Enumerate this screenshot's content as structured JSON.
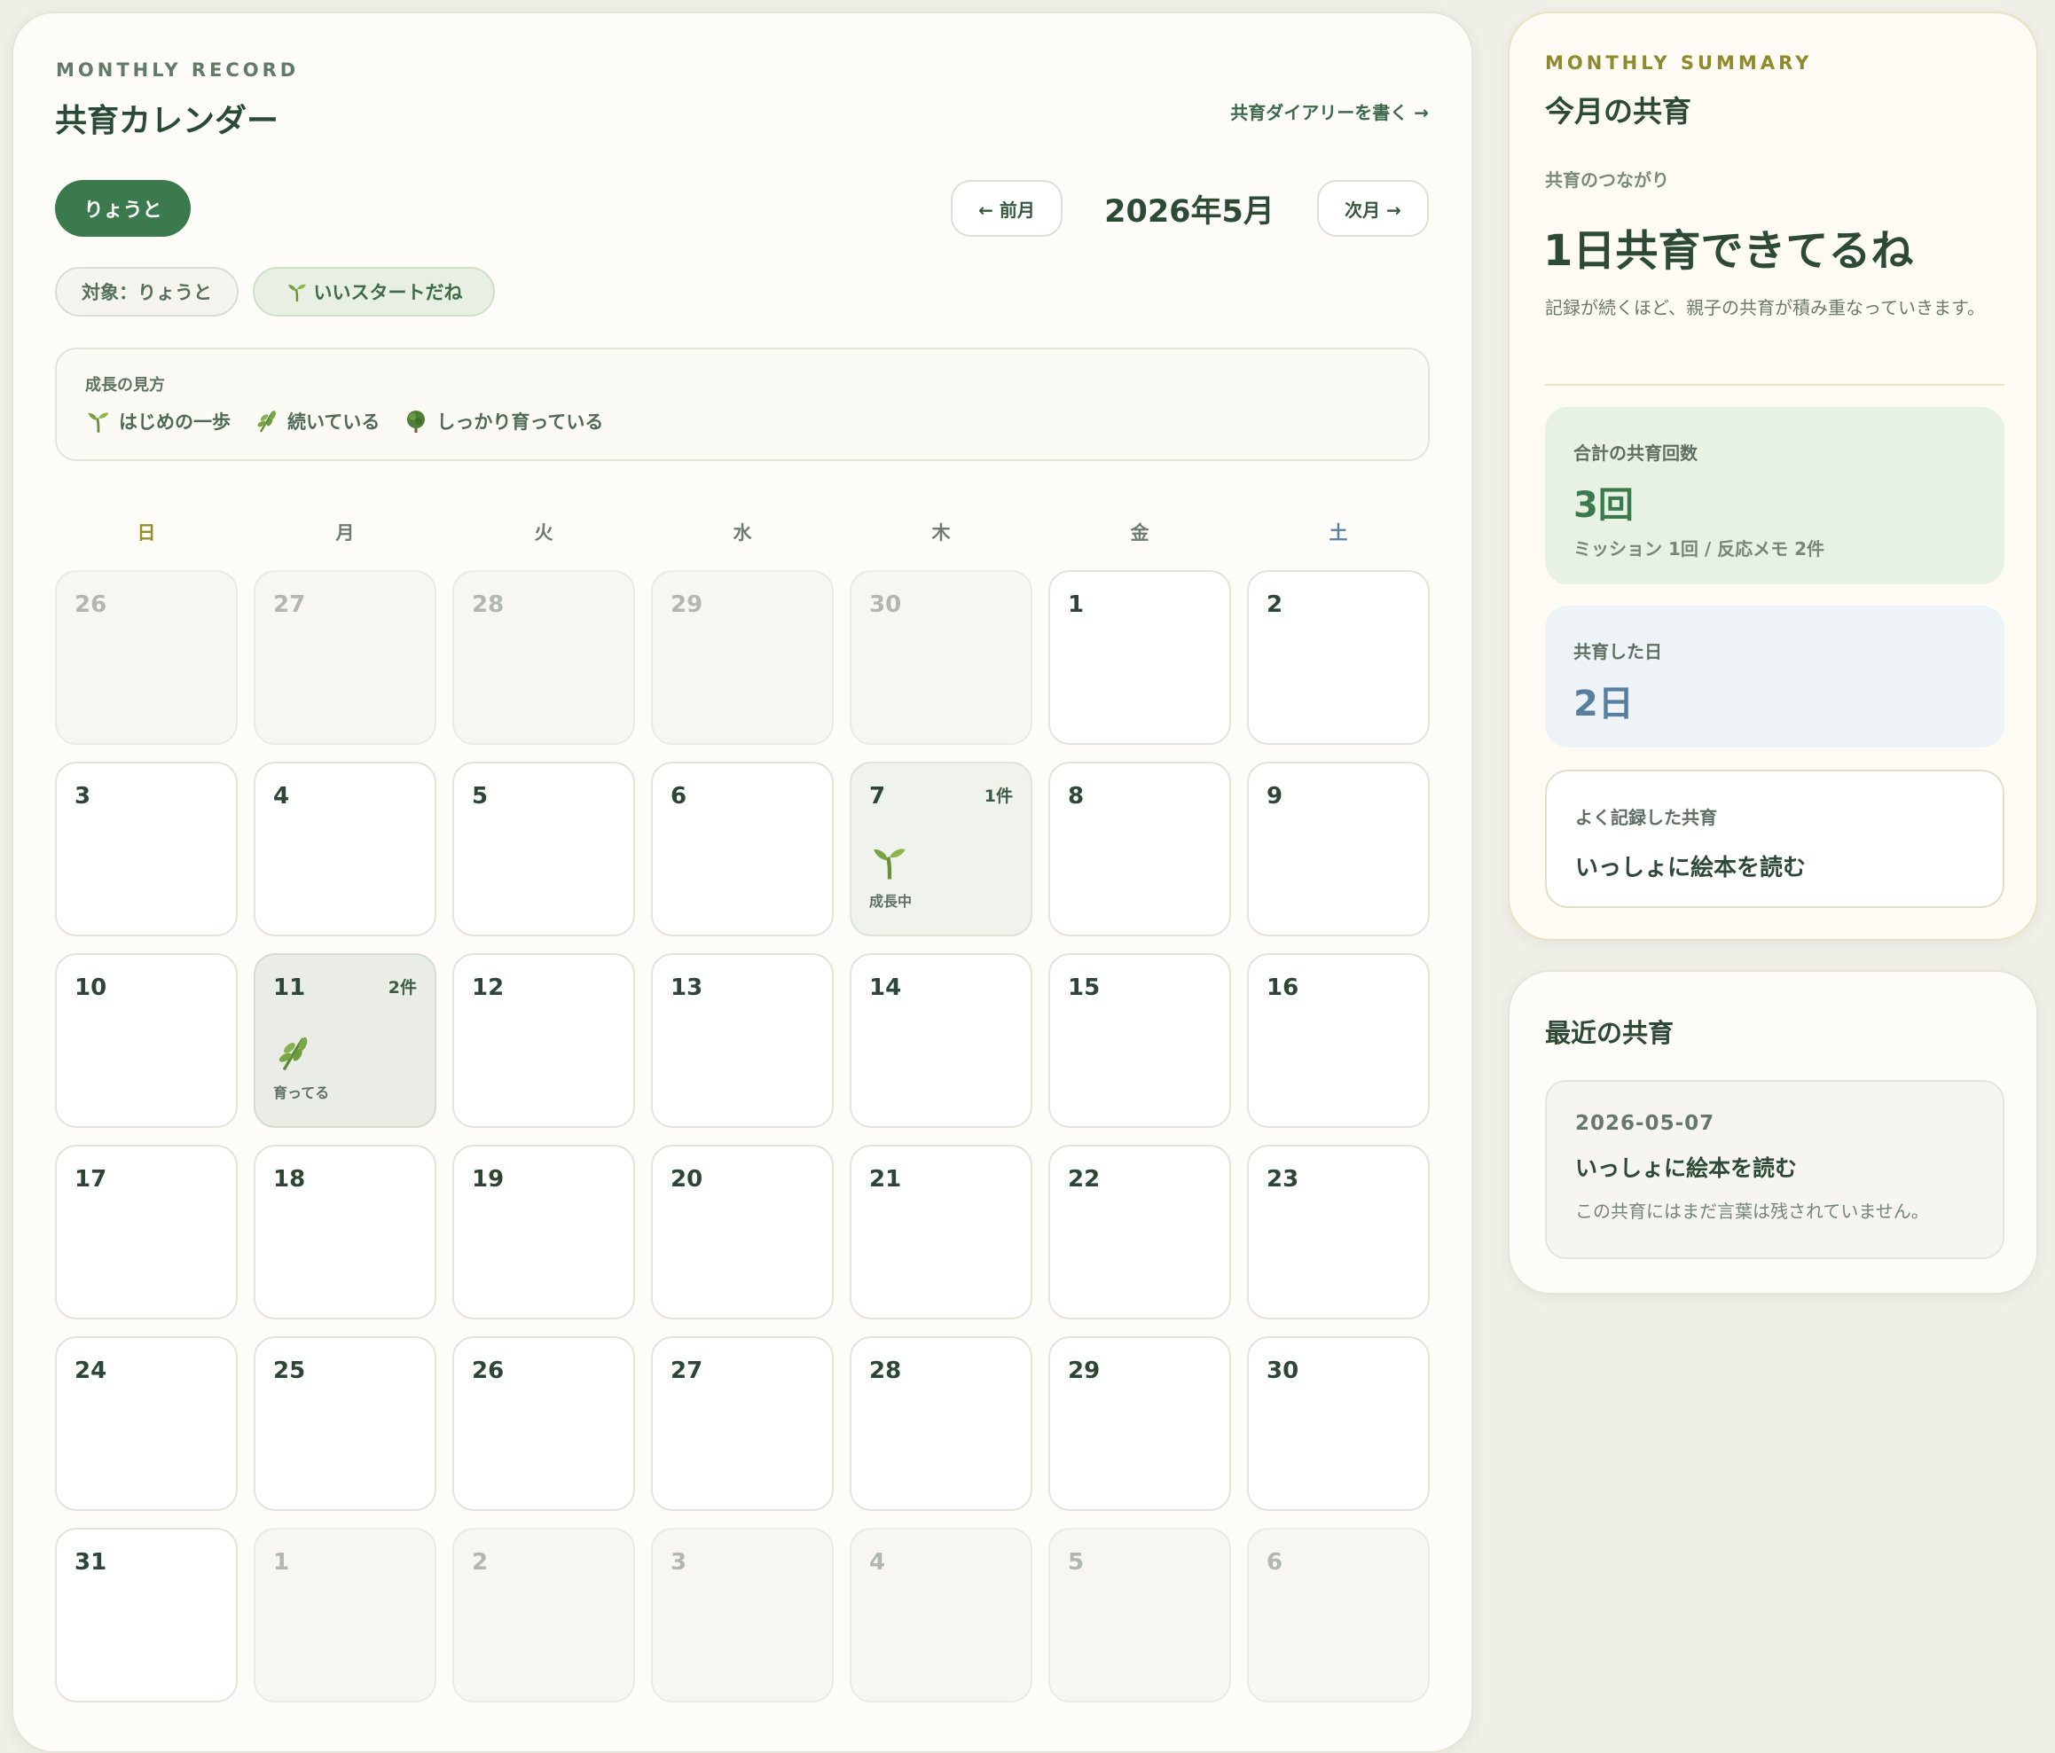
{
  "header": {
    "eyebrow": "MONTHLY RECORD",
    "title": "共育カレンダー",
    "diary_link": "共育ダイアリーを書く →"
  },
  "child_button": "りょうと",
  "nav": {
    "prev": "← 前月",
    "month": "2026年5月",
    "next": "次月 →"
  },
  "chips": {
    "target": "対象：りょうと",
    "start": "いいスタートだね"
  },
  "legend": {
    "title": "成長の見方",
    "items": [
      "はじめの一歩",
      "続いている",
      "しっかり育っている"
    ]
  },
  "weekdays": [
    "日",
    "月",
    "火",
    "水",
    "木",
    "金",
    "土"
  ],
  "calendar": {
    "weeks": [
      [
        {
          "d": "26",
          "o": true
        },
        {
          "d": "27",
          "o": true
        },
        {
          "d": "28",
          "o": true
        },
        {
          "d": "29",
          "o": true
        },
        {
          "d": "30",
          "o": true
        },
        {
          "d": "1"
        },
        {
          "d": "2"
        }
      ],
      [
        {
          "d": "3"
        },
        {
          "d": "4"
        },
        {
          "d": "5"
        },
        {
          "d": "6"
        },
        {
          "d": "7",
          "count": "1件",
          "label": "成長中",
          "icon": "sprout-icon",
          "level": 1
        },
        {
          "d": "8"
        },
        {
          "d": "9"
        }
      ],
      [
        {
          "d": "10"
        },
        {
          "d": "11",
          "count": "2件",
          "label": "育ってる",
          "icon": "leafy-branch-icon",
          "level": 2
        },
        {
          "d": "12"
        },
        {
          "d": "13"
        },
        {
          "d": "14"
        },
        {
          "d": "15"
        },
        {
          "d": "16"
        }
      ],
      [
        {
          "d": "17"
        },
        {
          "d": "18"
        },
        {
          "d": "19"
        },
        {
          "d": "20"
        },
        {
          "d": "21"
        },
        {
          "d": "22"
        },
        {
          "d": "23"
        }
      ],
      [
        {
          "d": "24"
        },
        {
          "d": "25"
        },
        {
          "d": "26"
        },
        {
          "d": "27"
        },
        {
          "d": "28"
        },
        {
          "d": "29"
        },
        {
          "d": "30"
        }
      ],
      [
        {
          "d": "31"
        },
        {
          "d": "1",
          "o": true
        },
        {
          "d": "2",
          "o": true
        },
        {
          "d": "3",
          "o": true
        },
        {
          "d": "4",
          "o": true
        },
        {
          "d": "5",
          "o": true
        },
        {
          "d": "6",
          "o": true
        }
      ]
    ]
  },
  "summary": {
    "eyebrow": "MONTHLY SUMMARY",
    "title": "今月の共育",
    "connection_label": "共育のつながり",
    "connection_value": "1日共育できてるね",
    "description": "記録が続くほど、親子の共育が積み重なっていきます。",
    "total": {
      "label": "合計の共育回数",
      "value": "3回",
      "sub": "ミッション 1回 / 反応メモ 2件"
    },
    "days": {
      "label": "共育した日",
      "value": "2日"
    },
    "most": {
      "label": "よく記録した共育",
      "value": "いっしょに絵本を読む"
    }
  },
  "recent": {
    "title": "最近の共育",
    "items": [
      {
        "date": "2026-05-07",
        "name": "いっしょに絵本を読む",
        "note": "この共育にはまだ言葉は残されていません。"
      }
    ]
  },
  "colors": {
    "accent_green": "#3a7a4d",
    "sunday": "#94912a",
    "saturday": "#5c80a0"
  }
}
